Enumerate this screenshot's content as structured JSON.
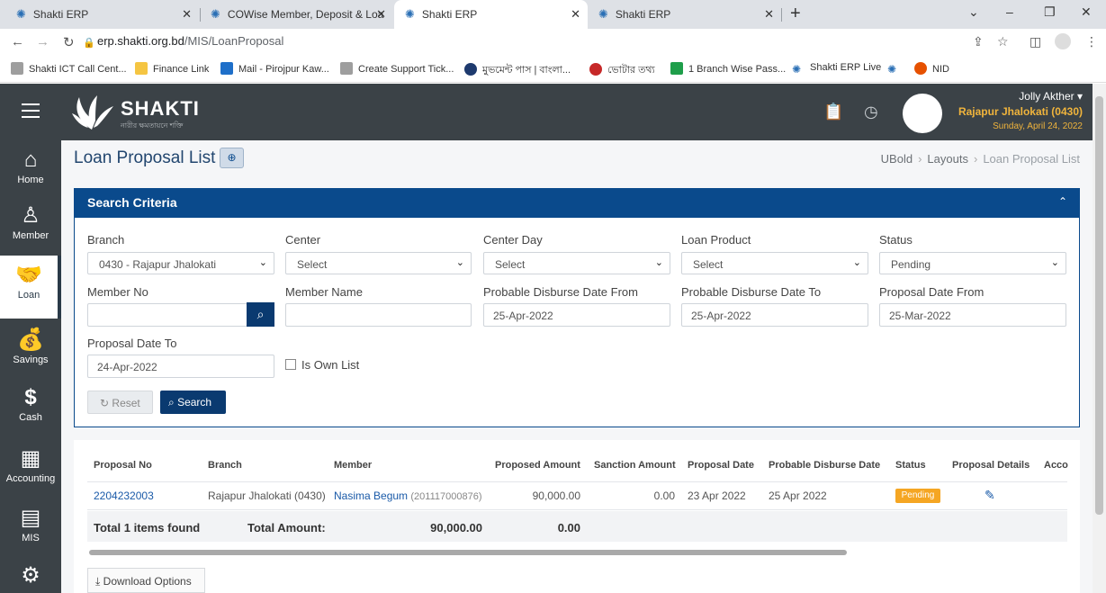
{
  "browser": {
    "tabs": [
      {
        "title": "Shakti ERP"
      },
      {
        "title": "COWise Member, Deposit & Loa"
      },
      {
        "title": "Shakti ERP"
      },
      {
        "title": "Shakti ERP"
      }
    ],
    "url_domain": "erp.shakti.org.bd",
    "url_path": "/MIS/LoanProposal",
    "bookmarks": [
      {
        "label": "Shakti ICT Call Cent...",
        "color": "#9e9e9e"
      },
      {
        "label": "Finance Link",
        "color": "#f5c542"
      },
      {
        "label": "Mail - Pirojpur Kaw...",
        "color": "#1e6fc9"
      },
      {
        "label": "Create Support Tick...",
        "color": "#9e9e9e"
      },
      {
        "label": "মুভমেন্ট পাস | বাংলা...",
        "color": "#1e3a6e"
      },
      {
        "label": "ভোটার তথ্য",
        "color": "#c62828"
      },
      {
        "label": "1 Branch Wise Pass...",
        "color": "#1e9e4a"
      },
      {
        "label": "Shakti ERP Live",
        "color": "#2a6fb5"
      },
      {
        "label": "",
        "color": "#2a6fb5"
      },
      {
        "label": "NID",
        "color": "#e65100"
      }
    ]
  },
  "header": {
    "logo_text": "SHAKTI",
    "logo_sub": "নারীর ক্ষমতায়নে শক্তি",
    "user_name": "Jolly Akther",
    "user_branch": "Rajapur Jhalokati (0430)",
    "date": "Sunday, April 24, 2022"
  },
  "sidebar": {
    "items": [
      {
        "label": "Home",
        "icon": "home-icon"
      },
      {
        "label": "Member",
        "icon": "user-icon"
      },
      {
        "label": "Loan",
        "icon": "handshake-icon"
      },
      {
        "label": "Savings",
        "icon": "money-bag-icon"
      },
      {
        "label": "Cash",
        "icon": "dollar-icon"
      },
      {
        "label": "Accounting",
        "icon": "calculator-icon"
      },
      {
        "label": "MIS",
        "icon": "report-icon"
      }
    ]
  },
  "page": {
    "title": "Loan Proposal List",
    "breadcrumb": [
      "UBold",
      "Layouts",
      "Loan Proposal List"
    ]
  },
  "search": {
    "title": "Search Criteria",
    "branch_label": "Branch",
    "branch_value": "0430 - Rajapur Jhalokati",
    "center_label": "Center",
    "center_value": "Select",
    "center_day_label": "Center Day",
    "center_day_value": "Select",
    "loan_product_label": "Loan Product",
    "loan_product_value": "Select",
    "status_label": "Status",
    "status_value": "Pending",
    "member_no_label": "Member No",
    "member_no_value": "",
    "member_name_label": "Member Name",
    "member_name_value": "",
    "disburse_from_label": "Probable Disburse Date From",
    "disburse_from_value": "25-Apr-2022",
    "disburse_to_label": "Probable Disburse Date To",
    "disburse_to_value": "25-Apr-2022",
    "proposal_from_label": "Proposal Date From",
    "proposal_from_value": "25-Mar-2022",
    "proposal_to_label": "Proposal Date To",
    "proposal_to_value": "24-Apr-2022",
    "own_list_label": "Is Own List",
    "reset_label": "Reset",
    "search_label": "Search"
  },
  "table": {
    "headers": [
      "Proposal No",
      "Branch",
      "Member",
      "Proposed Amount",
      "Sanction Amount",
      "Proposal Date",
      "Probable Disburse Date",
      "Status",
      "Proposal Details",
      "Acco"
    ],
    "rows": [
      {
        "proposal_no": "2204232003",
        "branch": "Rajapur Jhalokati (0430)",
        "member_name": "Nasima Begum",
        "member_id": "(201117000876)",
        "proposed_amount": "90,000.00",
        "sanction_amount": "0.00",
        "proposal_date": "23 Apr 2022",
        "disburse_date": "25 Apr 2022",
        "status": "Pending"
      }
    ],
    "total_prefix": "Total",
    "total_count": "1",
    "total_suffix": "items found",
    "total_amount_label": "Total Amount:",
    "total_proposed": "90,000.00",
    "total_sanction": "0.00",
    "download_label": "Download Options"
  }
}
